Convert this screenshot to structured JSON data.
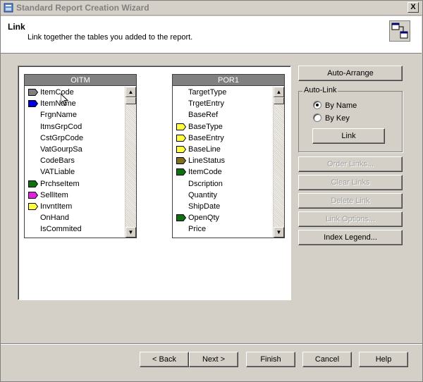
{
  "window": {
    "title": "Standard Report Creation Wizard",
    "close_label": "X"
  },
  "header": {
    "title": "Link",
    "subtitle": "Link together the tables you added to the report."
  },
  "tables": [
    {
      "name": "OITM",
      "fields": [
        {
          "label": "ItemCode",
          "icon": "key-icon",
          "color": "#808080"
        },
        {
          "label": "ItemName",
          "icon": "key-icon",
          "color": "#0000e0"
        },
        {
          "label": "FrgnName",
          "icon": "",
          "color": ""
        },
        {
          "label": "ItmsGrpCod",
          "icon": "",
          "color": ""
        },
        {
          "label": "CstGrpCode",
          "icon": "",
          "color": ""
        },
        {
          "label": "VatGourpSa",
          "icon": "",
          "color": ""
        },
        {
          "label": "CodeBars",
          "icon": "",
          "color": ""
        },
        {
          "label": "VATLiable",
          "icon": "",
          "color": ""
        },
        {
          "label": "PrchseItem",
          "icon": "key-icon",
          "color": "#107010"
        },
        {
          "label": "SellItem",
          "icon": "key-icon",
          "color": "#e020e0"
        },
        {
          "label": "InvntItem",
          "icon": "key-icon",
          "color": "#ffff40"
        },
        {
          "label": "OnHand",
          "icon": "",
          "color": ""
        },
        {
          "label": "IsCommited",
          "icon": "",
          "color": ""
        }
      ]
    },
    {
      "name": "POR1",
      "fields": [
        {
          "label": "TargetType",
          "icon": "",
          "color": ""
        },
        {
          "label": "TrgetEntry",
          "icon": "",
          "color": ""
        },
        {
          "label": "BaseRef",
          "icon": "",
          "color": ""
        },
        {
          "label": "BaseType",
          "icon": "key-icon",
          "color": "#ffff40"
        },
        {
          "label": "BaseEntry",
          "icon": "key-icon",
          "color": "#ffff40"
        },
        {
          "label": "BaseLine",
          "icon": "key-icon",
          "color": "#ffff40"
        },
        {
          "label": "LineStatus",
          "icon": "key-icon",
          "color": "#807020"
        },
        {
          "label": "ItemCode",
          "icon": "key-icon",
          "color": "#107010"
        },
        {
          "label": "Dscription",
          "icon": "",
          "color": ""
        },
        {
          "label": "Quantity",
          "icon": "",
          "color": ""
        },
        {
          "label": "ShipDate",
          "icon": "",
          "color": ""
        },
        {
          "label": "OpenQty",
          "icon": "key-icon",
          "color": "#107010"
        },
        {
          "label": "Price",
          "icon": "",
          "color": ""
        }
      ]
    }
  ],
  "actions": {
    "auto_arrange": "Auto-Arrange",
    "auto_link_label": "Auto-Link",
    "by_name": "By Name",
    "by_key": "By Key",
    "link": "Link",
    "order_links": "Order Links...",
    "clear_links": "Clear Links",
    "delete_link": "Delete Link",
    "link_options": "Link Options...",
    "index_legend": "Index Legend..."
  },
  "auto_link_selected": "By Name",
  "footer": {
    "back": "< Back",
    "next": "Next >",
    "finish": "Finish",
    "cancel": "Cancel",
    "help": "Help"
  }
}
